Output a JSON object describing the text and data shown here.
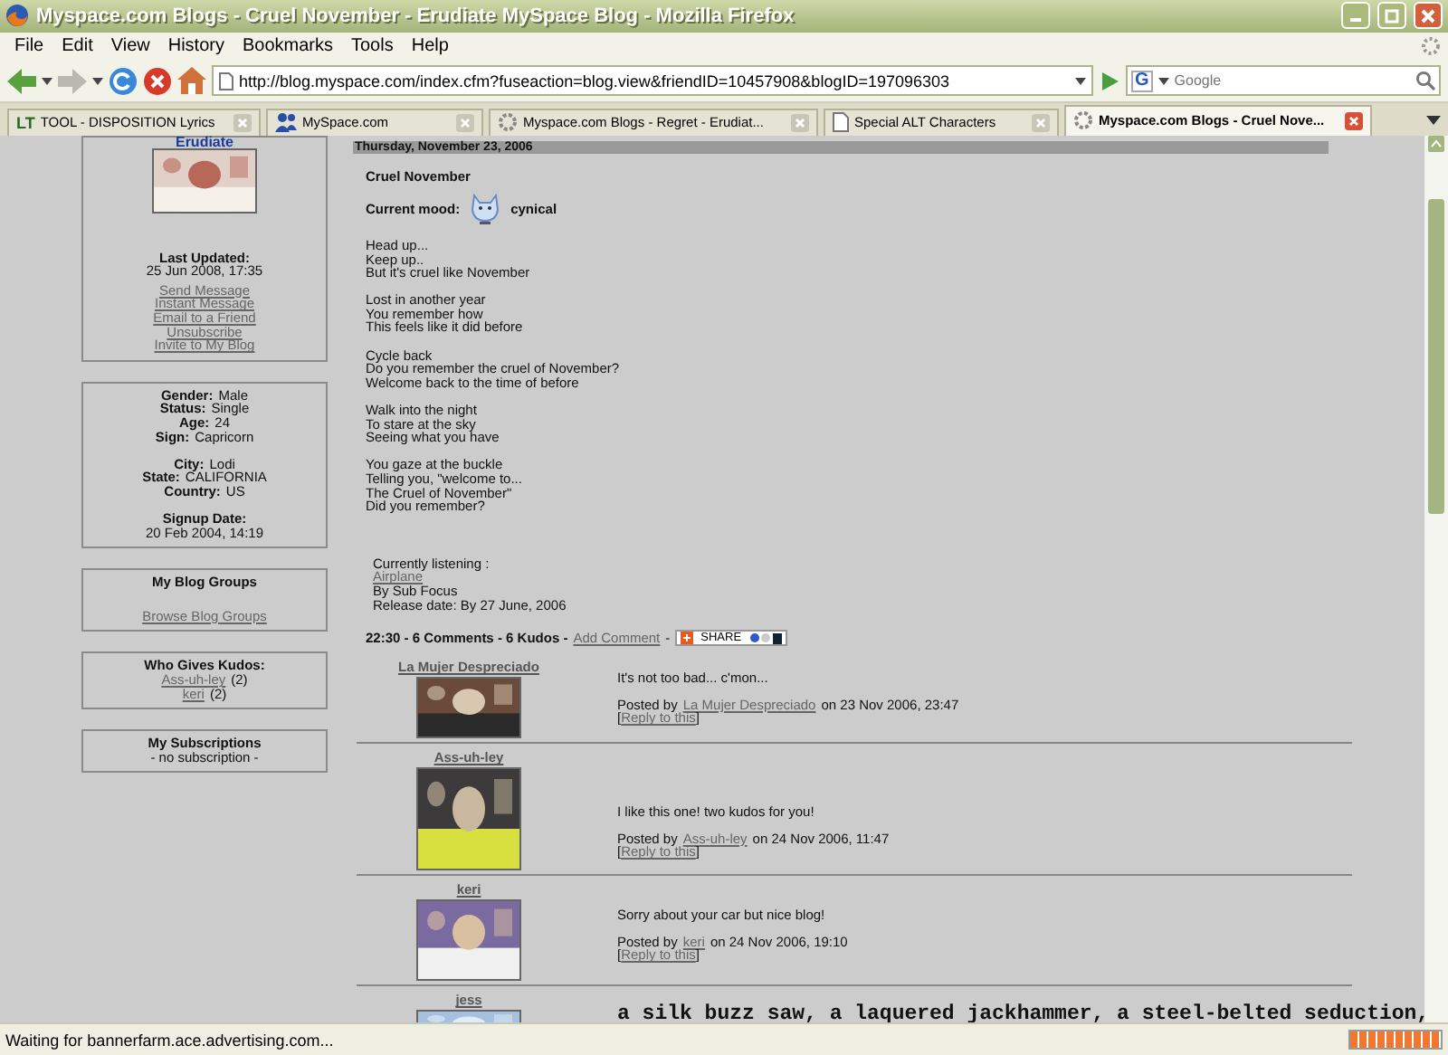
{
  "window": {
    "title": "Myspace.com Blogs - Cruel November - Erudiate MySpace Blog - Mozilla Firefox"
  },
  "menu": [
    "File",
    "Edit",
    "View",
    "History",
    "Bookmarks",
    "Tools",
    "Help"
  ],
  "address_bar": {
    "value": "http://blog.myspace.com/index.cfm?fuseaction=blog.view&friendID=10457908&blogID=197096303"
  },
  "search": {
    "engine_logo": "G",
    "placeholder": "Google"
  },
  "tabs": [
    {
      "label": "TOOL - DISPOSITION Lyrics",
      "kind": "text-logo",
      "logo": "LT",
      "selected": false
    },
    {
      "label": "MySpace.com",
      "kind": "site",
      "selected": false
    },
    {
      "label": "Myspace.com Blogs - Regret - Erudiat...",
      "kind": "loading",
      "selected": false
    },
    {
      "label": "Special ALT Characters",
      "kind": "page",
      "selected": false
    },
    {
      "label": "Myspace.com Blogs - Cruel Nove...",
      "kind": "loading",
      "selected": true
    }
  ],
  "sidebar": {
    "profile": {
      "name": "Erudiate",
      "last_updated_label": "Last Updated:",
      "last_updated": "25 Jun 2008, 17:35",
      "links": [
        "Send Message",
        "Instant Message",
        "Email to a Friend",
        "Unsubscribe",
        "Invite to My Blog"
      ]
    },
    "details": [
      [
        {
          "label": "Gender:",
          "value": "Male"
        },
        {
          "label": "Status:",
          "value": "Single"
        },
        {
          "label": "Age:",
          "value": "24"
        },
        {
          "label": "Sign:",
          "value": "Capricorn"
        }
      ],
      [
        {
          "label": "City:",
          "value": "Lodi"
        },
        {
          "label": "State:",
          "value": "CALIFORNIA"
        },
        {
          "label": "Country:",
          "value": "US"
        }
      ],
      [
        {
          "label": "Signup Date:",
          "value": "20 Feb 2004, 14:19",
          "kind": "stacked"
        }
      ]
    ],
    "blog_groups": {
      "title": "My Blog Groups",
      "link": "Browse Blog Groups"
    },
    "kudos": {
      "title": "Who Gives Kudos:",
      "givers": [
        {
          "name": "Ass-uh-ley",
          "count": "(2)"
        },
        {
          "name": "keri",
          "count": "(2)"
        }
      ]
    },
    "subscriptions": {
      "title": "My Subscriptions",
      "note": "- no subscription -"
    }
  },
  "post": {
    "date": "Thursday, November 23, 2006",
    "title": "Cruel November",
    "mood_label": "Current mood:",
    "mood": "cynical",
    "stanzas": [
      [
        "Head up...",
        "Keep up..",
        "But it's cruel like November"
      ],
      [
        "Lost in another year",
        "You remember how",
        "This feels like it did before"
      ],
      [
        "Cycle back",
        "Do you remember the cruel of November?",
        "Welcome back to the time of before"
      ],
      [
        "Walk into the night",
        "To stare at the sky",
        "Seeing what you have"
      ],
      [
        "You gaze at the buckle",
        "Telling you, \"welcome to...",
        "The Cruel of November\"",
        "Did you remember?"
      ]
    ],
    "listening": {
      "label": "Currently listening :",
      "song": "Airplane",
      "artist": "By Sub Focus",
      "release": "Release date: By 27 June, 2006"
    },
    "stats": "22:30 - 6 Comments - 6 Kudos -",
    "add_comment": "Add Comment",
    "separator": "-",
    "share": "SHARE"
  },
  "comments": [
    {
      "author": "La Mujer Despreciado",
      "kind": "normal",
      "text": "It's not too bad... c'mon...",
      "posted_by": "Posted by",
      "posted_author": "La Mujer Despreciado",
      "posted_on": "on 23 Nov 2006, 23:47",
      "reply": [
        "[",
        "Reply to this",
        "]"
      ]
    },
    {
      "author": "Ass-uh-ley",
      "kind": "normal",
      "text": "I like this one! two kudos for you!",
      "posted_by": "Posted by",
      "posted_author": "Ass-uh-ley",
      "posted_on": "on 24 Nov 2006, 11:47",
      "reply": [
        "[",
        "Reply to this",
        "]"
      ]
    },
    {
      "author": "keri",
      "kind": "normal",
      "text": "Sorry about your car but nice blog!",
      "posted_by": "Posted by",
      "posted_author": "keri",
      "posted_on": "on 24 Nov 2006, 19:10",
      "reply": [
        "[",
        "Reply to this",
        "]"
      ]
    },
    {
      "author": "jess",
      "kind": "big",
      "text": "a silk buzz saw, a laquered jackhammer, a steel-belted seduction,"
    }
  ],
  "status_bar": {
    "text": "Waiting for bannerfarm.ace.advertising.com...",
    "level": 1
  }
}
